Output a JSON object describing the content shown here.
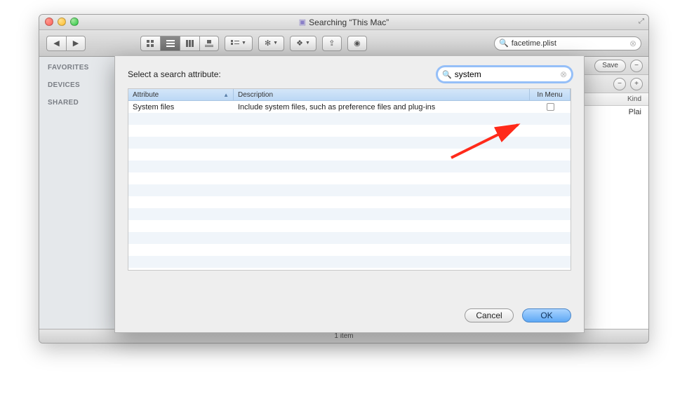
{
  "window": {
    "title": "Searching “This Mac”"
  },
  "toolbar": {
    "search_value": "facetime.plist"
  },
  "sidebar": {
    "headings": [
      "FAVORITES",
      "DEVICES",
      "SHARED"
    ]
  },
  "search_strip": {
    "save_label": "Save"
  },
  "columns": {
    "kind": "Kind"
  },
  "results": {
    "row1_kind": "Plai"
  },
  "statusbar": {
    "count": "1 item"
  },
  "sheet": {
    "title": "Select a search attribute:",
    "search_value": "system",
    "headers": {
      "attribute": "Attribute",
      "description": "Description",
      "in_menu": "In Menu"
    },
    "rows": [
      {
        "attribute": "System files",
        "description": "Include system files, such as preference files and plug-ins",
        "in_menu": false
      }
    ],
    "cancel_label": "Cancel",
    "ok_label": "OK"
  }
}
